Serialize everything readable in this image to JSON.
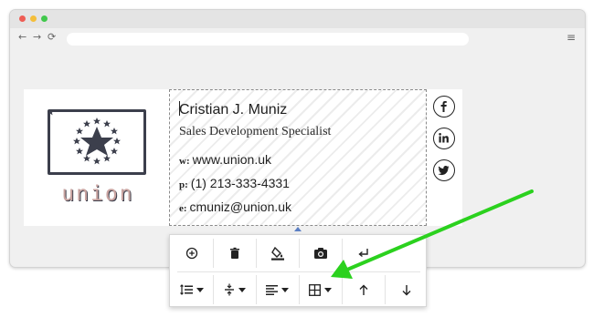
{
  "colors": {
    "accent_arrow": "#2bd11e",
    "logo_dark": "#3c3f4c",
    "logo_word": "#c9a3a0",
    "pointer_blue": "#5b7fc4",
    "traffic_red": "#ee5d54",
    "traffic_yellow": "#f4be3a",
    "traffic_green": "#41c84c"
  },
  "browser": {
    "url_placeholder": "",
    "back_glyph": "←",
    "forward_glyph": "→",
    "reload_glyph": "⟳",
    "menu_glyph": "≡"
  },
  "logo": {
    "word": "union",
    "icon": "eu-stars-flag-icon"
  },
  "signature": {
    "name": "Cristian J. Muniz",
    "title": "Sales Development Specialist",
    "website_label": "w:",
    "website": "www.union.uk",
    "phone_label": "p:",
    "phone": "(1) 213-333-4331",
    "email_label": "e:",
    "email": "cmuniz@union.uk"
  },
  "social": [
    {
      "name": "facebook",
      "icon": "facebook-icon"
    },
    {
      "name": "linkedin",
      "icon": "linkedin-icon"
    },
    {
      "name": "twitter",
      "icon": "twitter-icon"
    }
  ],
  "toolbar": {
    "row1": [
      {
        "icon": "add-circle-icon"
      },
      {
        "icon": "trash-icon"
      },
      {
        "icon": "fill-color-icon"
      },
      {
        "icon": "camera-icon"
      },
      {
        "icon": "enter-return-icon"
      }
    ],
    "row2": [
      {
        "icon": "line-spacing-icon",
        "dropdown": true
      },
      {
        "icon": "vertical-spacing-icon",
        "dropdown": true
      },
      {
        "icon": "align-left-icon",
        "dropdown": true
      },
      {
        "icon": "table-grid-icon",
        "dropdown": true
      },
      {
        "icon": "move-up-icon"
      },
      {
        "icon": "move-down-icon"
      }
    ]
  }
}
